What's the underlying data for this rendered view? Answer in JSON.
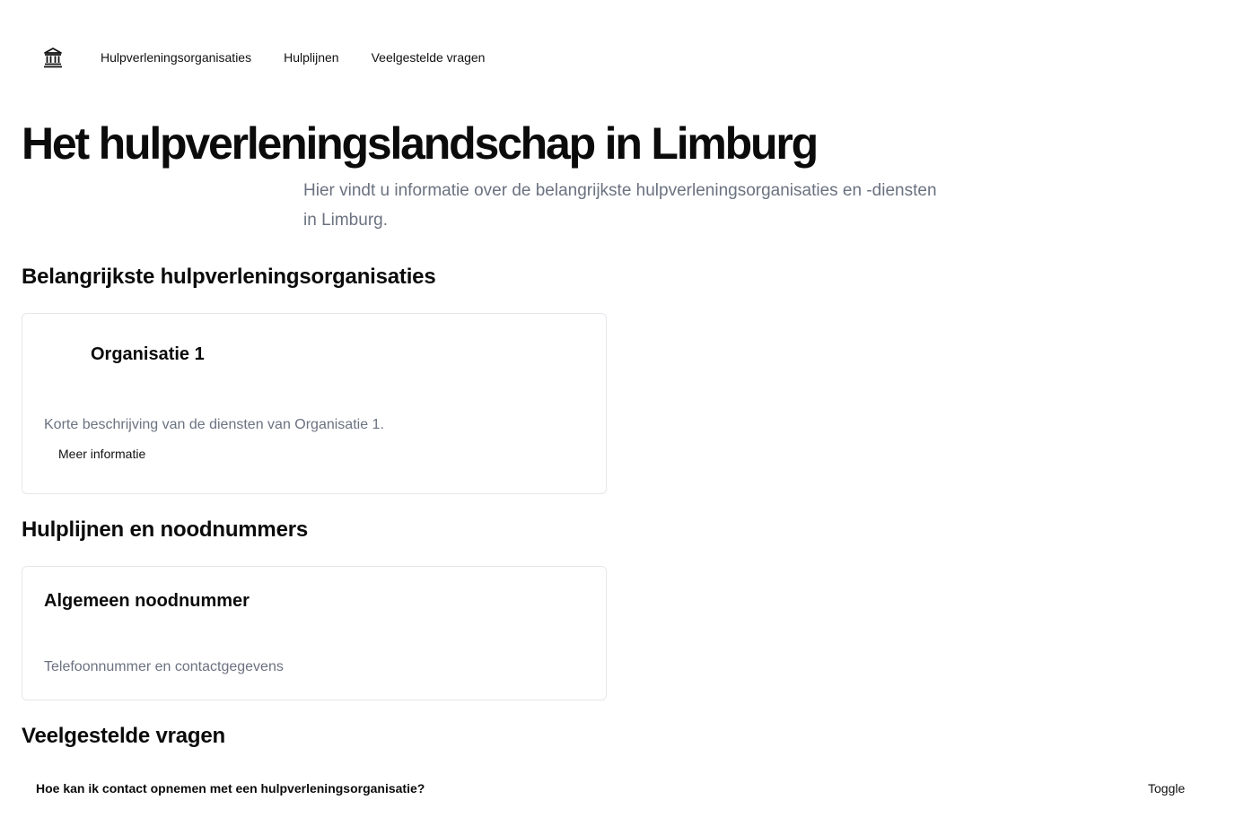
{
  "nav": {
    "home_icon": "bank-icon",
    "items": [
      {
        "label": "Hulpverleningsorganisaties"
      },
      {
        "label": "Hulplijnen"
      },
      {
        "label": "Veelgestelde vragen"
      }
    ]
  },
  "hero": {
    "title": "Het hulpverleningslandschap in Limburg",
    "subtitle": "Hier vindt u informatie over de belangrijkste hulpverleningsorganisaties en -diensten in Limburg."
  },
  "organizations": {
    "heading": "Belangrijkste hulpverleningsorganisaties",
    "cards": [
      {
        "title": "Organisatie 1",
        "description": "Korte beschrijving van de diensten van Organisatie 1.",
        "link": "Meer informatie"
      }
    ]
  },
  "helplines": {
    "heading": "Hulplijnen en noodnummers",
    "cards": [
      {
        "title": "Algemeen noodnummer",
        "description": "Telefoonnummer en contactgegevens"
      }
    ]
  },
  "faq": {
    "heading": "Veelgestelde vragen",
    "items": [
      {
        "question": "Hoe kan ik contact opnemen met een hulpverleningsorganisatie?",
        "toggle": "Toggle"
      }
    ]
  },
  "colors": {
    "text": "#0b0b0b",
    "muted": "#6b7280",
    "border": "#e5e7eb"
  }
}
